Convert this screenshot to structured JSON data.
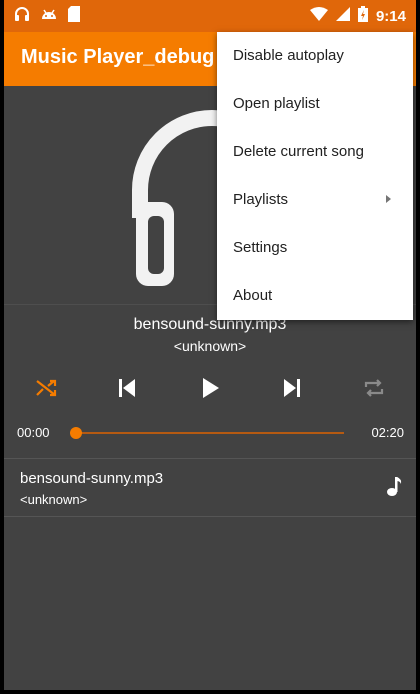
{
  "statusbar": {
    "time": "9:14",
    "icons_left": [
      "headphones-icon",
      "android-icon",
      "sd-card-icon"
    ],
    "icons_right": [
      "wifi-icon",
      "signal-icon",
      "battery-icon"
    ]
  },
  "appbar": {
    "title": "Music Player_debug"
  },
  "now_playing": {
    "title": "bensound-sunny.mp3",
    "artist": "<unknown>"
  },
  "controls": {
    "shuffle_active": true,
    "accent": "#f57c00"
  },
  "seek": {
    "current": "00:00",
    "duration": "02:20",
    "progress": 0
  },
  "playlist": [
    {
      "title": "bensound-sunny.mp3",
      "artist": "<unknown>"
    }
  ],
  "menu": {
    "items": [
      {
        "label": "Disable autoplay"
      },
      {
        "label": "Open playlist"
      },
      {
        "label": "Delete current song"
      },
      {
        "label": "Playlists",
        "has_submenu": true
      },
      {
        "label": "Settings"
      },
      {
        "label": "About"
      }
    ]
  },
  "colors": {
    "primary": "#f57c00",
    "status": "#e0670a",
    "background": "#424242"
  }
}
